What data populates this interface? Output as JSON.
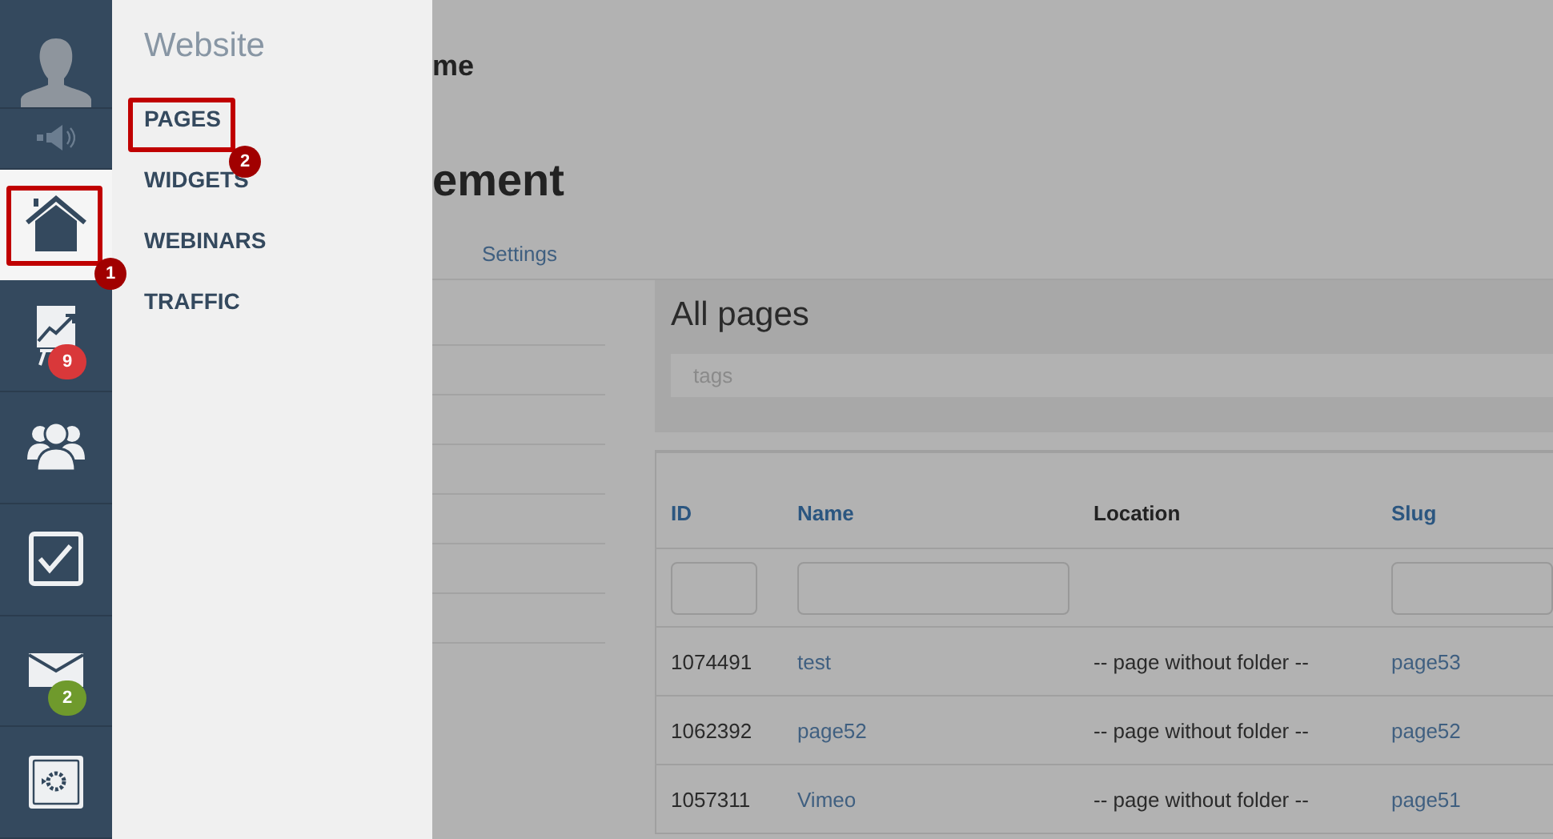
{
  "rail": [
    {
      "kind": "avatar",
      "selected": false
    },
    {
      "kind": "speaker",
      "selected": false
    },
    {
      "kind": "home",
      "selected": true
    },
    {
      "kind": "chart",
      "selected": false,
      "badge": "9",
      "color": "#d9383a"
    },
    {
      "kind": "people",
      "selected": false
    },
    {
      "kind": "check",
      "selected": false
    },
    {
      "kind": "mail",
      "selected": false,
      "badge": "2",
      "color": "#6f9a2c"
    },
    {
      "kind": "safe",
      "selected": false
    }
  ],
  "submenu": {
    "title": "Website",
    "items": [
      {
        "label": "PAGES"
      },
      {
        "label": "WIDGETS"
      },
      {
        "label": "WEBINARS"
      },
      {
        "label": "TRAFFIC"
      }
    ]
  },
  "annotations": [
    {
      "label": "1"
    },
    {
      "label": "2"
    }
  ],
  "main": {
    "subtitle": "me",
    "title": "ement",
    "tab": "Settings",
    "panel": {
      "title": "All pages",
      "tags": {
        "placeholder": "tags"
      }
    },
    "table": {
      "columns": [
        {
          "label": "ID",
          "sortable": true
        },
        {
          "label": "Name",
          "sortable": true
        },
        {
          "label": "Location",
          "sortable": false
        },
        {
          "label": "Slug",
          "sortable": true
        }
      ],
      "rows": [
        {
          "id": "1074491",
          "name": "test",
          "location": "-- page without folder --",
          "slug": "page53"
        },
        {
          "id": "1062392",
          "name": "page52",
          "location": "-- page without folder --",
          "slug": "page52"
        },
        {
          "id": "1057311",
          "name": "Vimeo",
          "location": "-- page without folder --",
          "slug": "page51"
        }
      ]
    }
  }
}
